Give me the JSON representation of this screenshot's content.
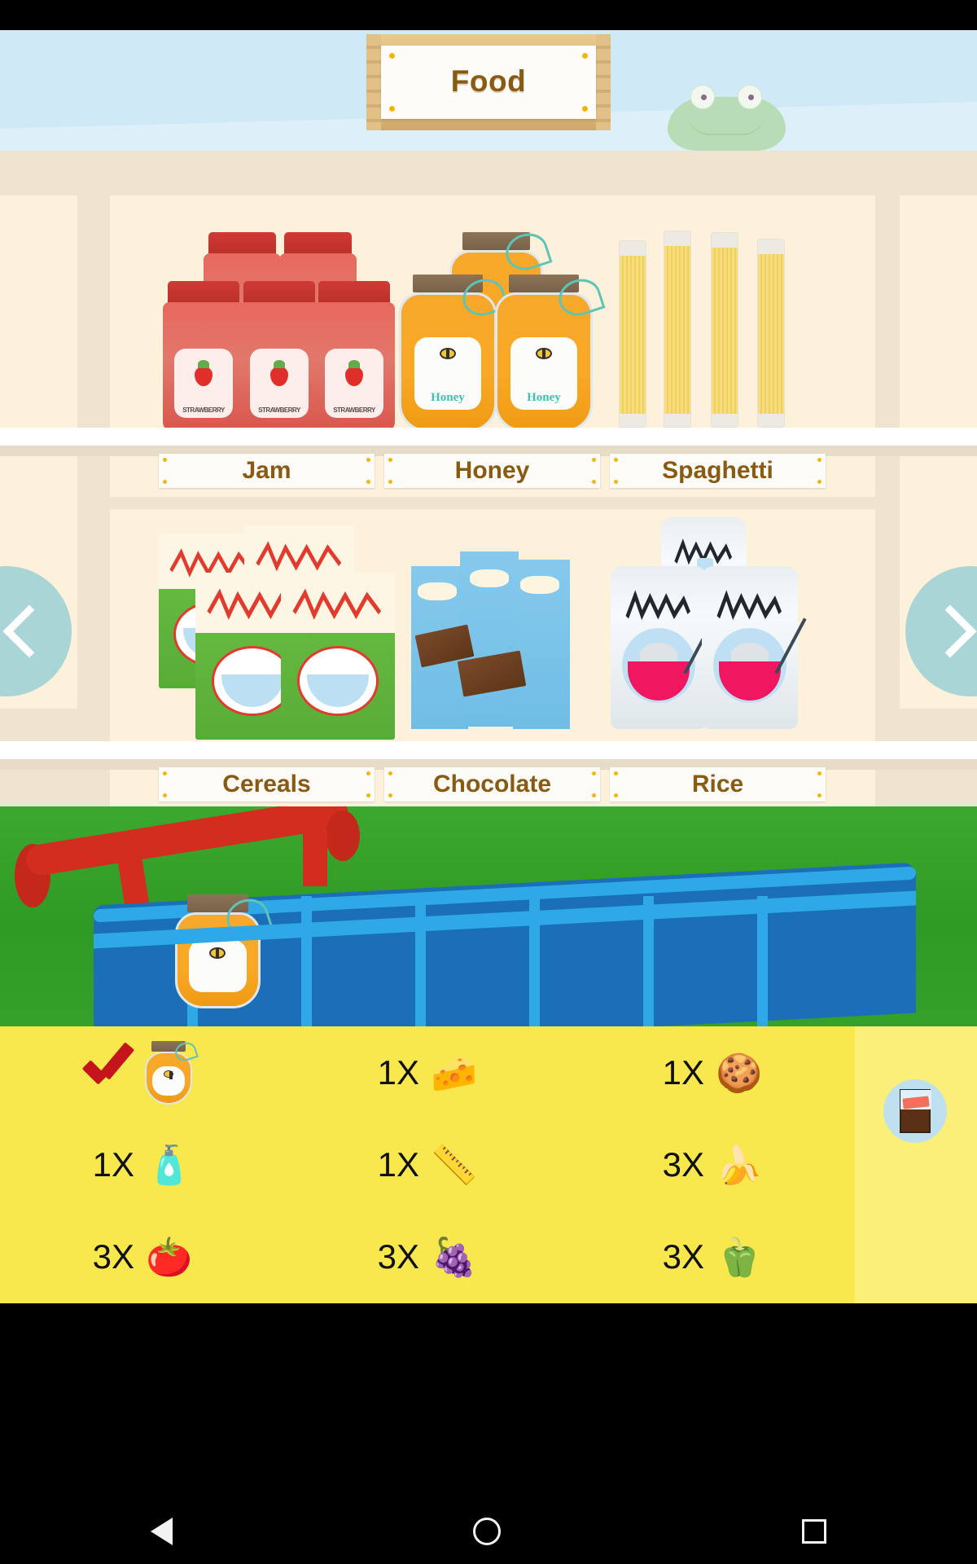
{
  "header": {
    "title": "Food",
    "frog_icon": "frog-character"
  },
  "navigation": {
    "prev_label": "<",
    "next_label": ">",
    "prev_icon": "chevron-left-icon",
    "next_icon": "chevron-right-icon"
  },
  "shelves": [
    {
      "products": [
        {
          "name": "Jam",
          "icon": "jam-jar-icon",
          "label_text": "STRAWBERRY"
        },
        {
          "name": "Honey",
          "icon": "honey-jar-icon",
          "label_text": "Honey"
        },
        {
          "name": "Spaghetti",
          "icon": "spaghetti-pack-icon"
        }
      ]
    },
    {
      "products": [
        {
          "name": "Cereals",
          "icon": "cereal-box-icon"
        },
        {
          "name": "Chocolate",
          "icon": "chocolate-bar-icon"
        },
        {
          "name": "Rice",
          "icon": "rice-bag-icon"
        }
      ]
    }
  ],
  "cart": {
    "icon": "shopping-cart",
    "contents": [
      {
        "name": "Honey",
        "icon": "honey-jar-icon"
      }
    ]
  },
  "shopping_list": {
    "items": [
      {
        "qty": "",
        "collected": true,
        "check": "✔",
        "emoji": "",
        "icon": "honey-jar-icon",
        "name": "honey"
      },
      {
        "qty": "1X",
        "collected": false,
        "emoji": "🧀",
        "icon": "cheese-icon",
        "name": "cheese"
      },
      {
        "qty": "1X",
        "collected": false,
        "emoji": "🍪",
        "icon": "cookie-icon",
        "name": "cookie"
      },
      {
        "qty": "1X",
        "collected": false,
        "emoji": "🧴",
        "icon": "soap-bottle-icon",
        "name": "soap"
      },
      {
        "qty": "1X",
        "collected": false,
        "emoji": "📏",
        "icon": "ruler-icon",
        "name": "ruler"
      },
      {
        "qty": "3X",
        "collected": false,
        "emoji": "🍌",
        "icon": "banana-icon",
        "name": "banana"
      },
      {
        "qty": "3X",
        "collected": false,
        "emoji": "🍅",
        "icon": "tomato-icon",
        "name": "tomato"
      },
      {
        "qty": "3X",
        "collected": false,
        "emoji": "🍇",
        "icon": "grapes-icon",
        "name": "grapes"
      },
      {
        "qty": "3X",
        "collected": false,
        "emoji": "🫑",
        "icon": "bell-pepper-icon",
        "name": "bell-pepper"
      }
    ],
    "action_button": {
      "icon": "signboard-icon",
      "label": ""
    }
  },
  "system_nav": {
    "back": "back-icon",
    "home": "home-icon",
    "recent": "recent-apps-icon"
  },
  "colors": {
    "sky": "#cfe9f7",
    "shelf_bg": "#fdf1db",
    "store_bg": "#efe4cf",
    "sign_text": "#8a5a12",
    "list_bg": "#f9e74e",
    "grass": "#35a02a",
    "cart_blue": "#1a6fb8",
    "cart_red": "#d22d1e",
    "check_red": "#c4151c",
    "arrow_blue": "rgba(137,203,214,.72)"
  }
}
